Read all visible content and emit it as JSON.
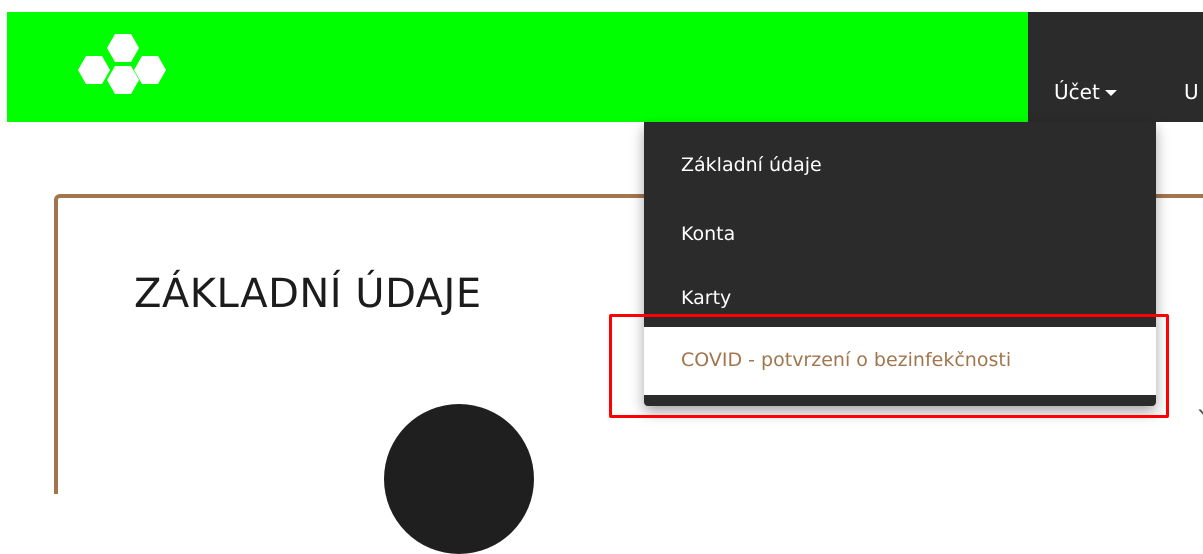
{
  "header": {
    "logo_icon": "hexagons-logo-icon",
    "brand_color": "#00ff00",
    "nav": {
      "account_label": "Účet",
      "next_label": "U"
    }
  },
  "dropdown": {
    "items": [
      {
        "label": "Základní údaje"
      },
      {
        "label": "Konta"
      },
      {
        "label": "Karty"
      },
      {
        "label": "COVID - potvrzení o bezinfekčnosti"
      }
    ]
  },
  "page": {
    "title": "ZÁKLADNÍ ÚDAJE",
    "accent_color": "#a1764d"
  },
  "annotation": {
    "highlight_color": "#ff0000"
  }
}
